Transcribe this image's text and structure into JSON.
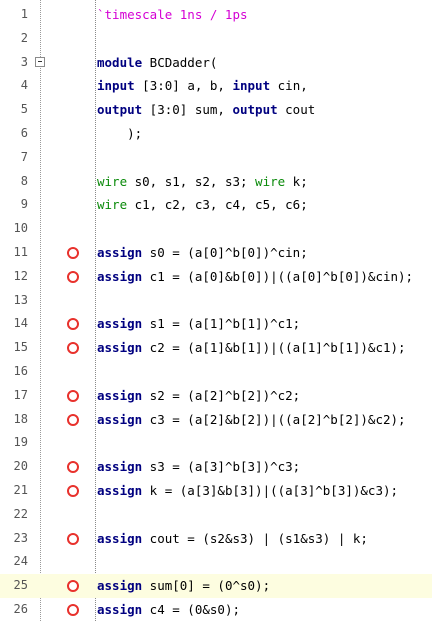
{
  "editor": {
    "lines": [
      {
        "num": "1",
        "tokens": [
          {
            "t": "`timescale 1ns / 1ps",
            "c": "dir"
          }
        ]
      },
      {
        "num": "2",
        "tokens": []
      },
      {
        "num": "3",
        "tokens": [
          {
            "t": "module",
            "c": "kw"
          },
          {
            "t": " BCDadder(",
            "c": ""
          }
        ],
        "fold": true
      },
      {
        "num": "4",
        "tokens": [
          {
            "t": "input",
            "c": "kw"
          },
          {
            "t": " [3:0] a, b, ",
            "c": ""
          },
          {
            "t": "input",
            "c": "kw"
          },
          {
            "t": " cin,",
            "c": ""
          }
        ]
      },
      {
        "num": "5",
        "tokens": [
          {
            "t": "output",
            "c": "kw"
          },
          {
            "t": " [3:0] sum, ",
            "c": ""
          },
          {
            "t": "output",
            "c": "kw"
          },
          {
            "t": " cout",
            "c": ""
          }
        ]
      },
      {
        "num": "6",
        "tokens": [
          {
            "t": "    );",
            "c": ""
          }
        ]
      },
      {
        "num": "7",
        "tokens": []
      },
      {
        "num": "8",
        "tokens": [
          {
            "t": "wire",
            "c": "kw2"
          },
          {
            "t": " s0, s1, s2, s3; ",
            "c": ""
          },
          {
            "t": "wire",
            "c": "kw2"
          },
          {
            "t": " k;",
            "c": ""
          }
        ]
      },
      {
        "num": "9",
        "tokens": [
          {
            "t": "wire",
            "c": "kw2"
          },
          {
            "t": " c1, c2, c3, c4, c5, c6;",
            "c": ""
          }
        ]
      },
      {
        "num": "10",
        "tokens": []
      },
      {
        "num": "11",
        "tokens": [
          {
            "t": "assign",
            "c": "kw"
          },
          {
            "t": " s0 = (a[0]^b[0])^cin;",
            "c": ""
          }
        ],
        "bp": true
      },
      {
        "num": "12",
        "tokens": [
          {
            "t": "assign",
            "c": "kw"
          },
          {
            "t": " c1 = (a[0]&b[0])|((a[0]^b[0])&cin);",
            "c": ""
          }
        ],
        "bp": true
      },
      {
        "num": "13",
        "tokens": []
      },
      {
        "num": "14",
        "tokens": [
          {
            "t": "assign",
            "c": "kw"
          },
          {
            "t": " s1 = (a[1]^b[1])^c1;",
            "c": ""
          }
        ],
        "bp": true
      },
      {
        "num": "15",
        "tokens": [
          {
            "t": "assign",
            "c": "kw"
          },
          {
            "t": " c2 = (a[1]&b[1])|((a[1]^b[1])&c1);",
            "c": ""
          }
        ],
        "bp": true
      },
      {
        "num": "16",
        "tokens": []
      },
      {
        "num": "17",
        "tokens": [
          {
            "t": "assign",
            "c": "kw"
          },
          {
            "t": " s2 = (a[2]^b[2])^c2;",
            "c": ""
          }
        ],
        "bp": true
      },
      {
        "num": "18",
        "tokens": [
          {
            "t": "assign",
            "c": "kw"
          },
          {
            "t": " c3 = (a[2]&b[2])|((a[2]^b[2])&c2);",
            "c": ""
          }
        ],
        "bp": true
      },
      {
        "num": "19",
        "tokens": []
      },
      {
        "num": "20",
        "tokens": [
          {
            "t": "assign",
            "c": "kw"
          },
          {
            "t": " s3 = (a[3]^b[3])^c3;",
            "c": ""
          }
        ],
        "bp": true
      },
      {
        "num": "21",
        "tokens": [
          {
            "t": "assign",
            "c": "kw"
          },
          {
            "t": " k = (a[3]&b[3])|((a[3]^b[3])&c3);",
            "c": ""
          }
        ],
        "bp": true
      },
      {
        "num": "22",
        "tokens": []
      },
      {
        "num": "23",
        "tokens": [
          {
            "t": "assign",
            "c": "kw"
          },
          {
            "t": " cout = (s2&s3) | (s1&s3) | k;",
            "c": ""
          }
        ],
        "bp": true
      },
      {
        "num": "24",
        "tokens": []
      },
      {
        "num": "25",
        "tokens": [
          {
            "t": "assign",
            "c": "kw"
          },
          {
            "t": " sum[0] = (0^s0);",
            "c": ""
          }
        ],
        "bp": true,
        "current": true
      },
      {
        "num": "26",
        "tokens": [
          {
            "t": "assign",
            "c": "kw"
          },
          {
            "t": " c4 = (0&s0);",
            "c": ""
          }
        ],
        "bp": true
      }
    ]
  },
  "colors": {
    "keyword": "#000080",
    "wire_keyword": "#0a8a0a",
    "directive": "#d400d4",
    "breakpoint": "#e8312c",
    "current_line": "#fdfde0"
  }
}
